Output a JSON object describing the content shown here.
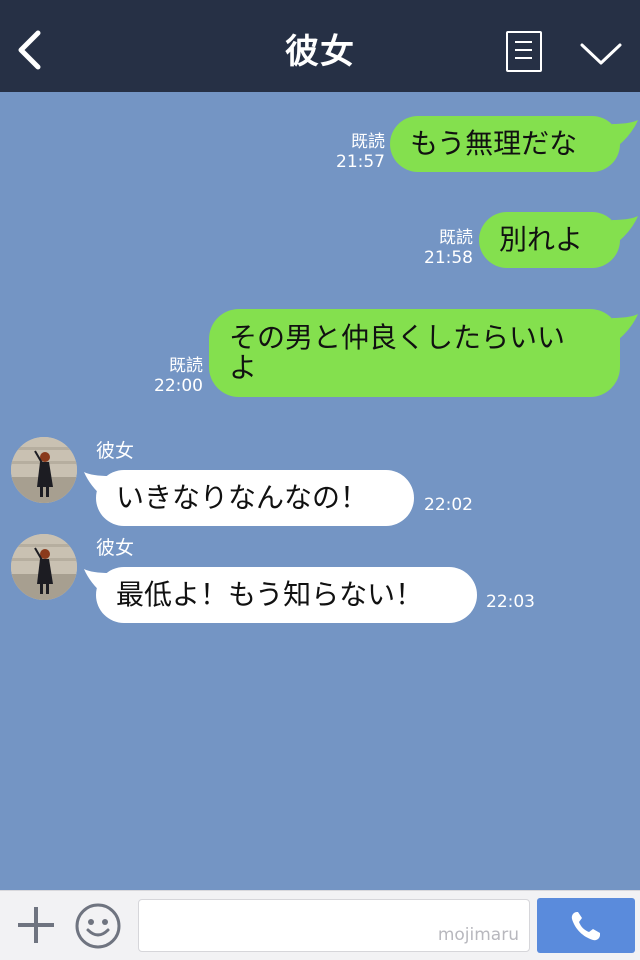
{
  "header": {
    "title": "彼女"
  },
  "messages": {
    "sent": [
      {
        "text": "もう無理だな",
        "read": "既読",
        "time": "21:57"
      },
      {
        "text": "別れよ",
        "read": "既読",
        "time": "21:58"
      },
      {
        "text_line1": "その男と仲良くしたらいい",
        "text_line2": "よ",
        "read": "既読",
        "time": "22:00"
      }
    ],
    "received": [
      {
        "sender": "彼女",
        "text": "いきなりなんなの！",
        "time": "22:02"
      },
      {
        "sender": "彼女",
        "text": "最低よ！もう知らない！",
        "time": "22:03"
      }
    ]
  },
  "footer": {
    "watermark": "mojimaru"
  },
  "colors": {
    "background": "#7495c4",
    "header": "#263045",
    "sent_bubble": "#84e04e",
    "received_bubble": "#ffffff",
    "call_button": "#5a8bdc"
  },
  "icons": [
    "back-arrow-icon",
    "menu-list-icon",
    "chevron-down-icon",
    "plus-icon",
    "emoji-icon",
    "phone-icon"
  ]
}
